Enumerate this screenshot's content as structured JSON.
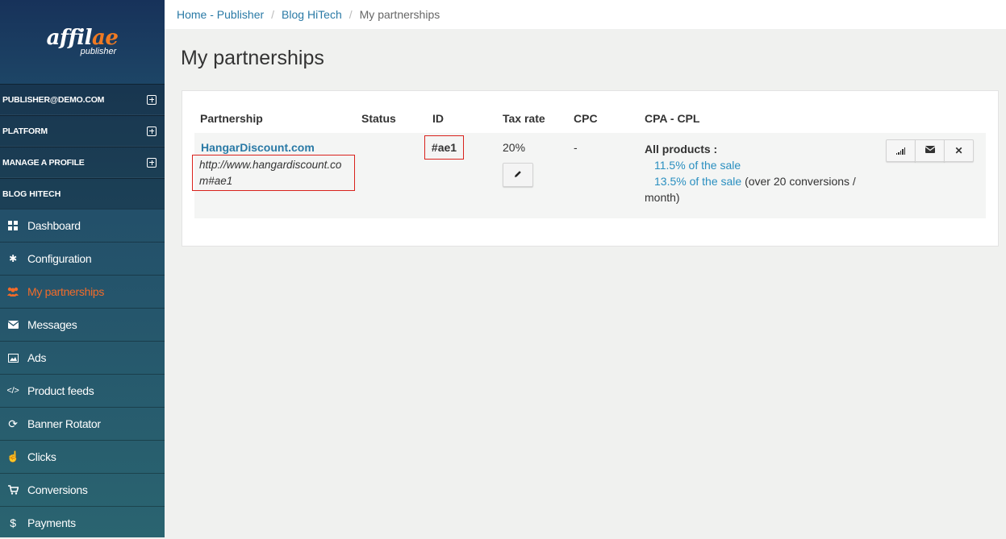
{
  "logo": {
    "main_a": "affil",
    "main_b": "ae",
    "sub": "publisher"
  },
  "sidebar": {
    "sections": [
      {
        "label": "PUBLISHER@DEMO.COM"
      },
      {
        "label": "PLATFORM"
      },
      {
        "label": "MANAGE A PROFILE"
      }
    ],
    "profile_label": "BLOG HITECH",
    "items": [
      {
        "label": "Dashboard",
        "icon": "dashboard-icon"
      },
      {
        "label": "Configuration",
        "icon": "gear-icon"
      },
      {
        "label": "My partnerships",
        "icon": "users-icon",
        "active": true
      },
      {
        "label": "Messages",
        "icon": "envelope-icon"
      },
      {
        "label": "Ads",
        "icon": "picture-icon"
      },
      {
        "label": "Product feeds",
        "icon": "code-icon"
      },
      {
        "label": "Banner Rotator",
        "icon": "refresh-icon"
      },
      {
        "label": "Clicks",
        "icon": "hand-pointer-icon"
      },
      {
        "label": "Conversions",
        "icon": "cart-icon"
      },
      {
        "label": "Payments",
        "icon": "dollar-icon"
      }
    ]
  },
  "breadcrumb": {
    "home": "Home - Publisher",
    "profile": "Blog HiTech",
    "current": "My partnerships",
    "separator": "/"
  },
  "page_title": "My partnerships",
  "table": {
    "headers": {
      "partnership": "Partnership",
      "status": "Status",
      "id": "ID",
      "tax_rate": "Tax rate",
      "cpc": "CPC",
      "cpa": "CPA - CPL"
    },
    "row": {
      "name": "HangarDiscount.com",
      "url": "http://www.hangardiscount.com#ae1",
      "id": "#ae1",
      "tax_rate": "20%",
      "cpc": "-",
      "cpa_label": "All products :",
      "cpa_line1": "11.5% of the sale",
      "cpa_line2": "13.5% of the sale",
      "cpa_line2_suffix": " (over 20 conversions / month)"
    }
  },
  "colors": {
    "accent_link": "#2a7aa6",
    "active_nav": "#f26b2a",
    "highlight_border": "#d9221c"
  }
}
